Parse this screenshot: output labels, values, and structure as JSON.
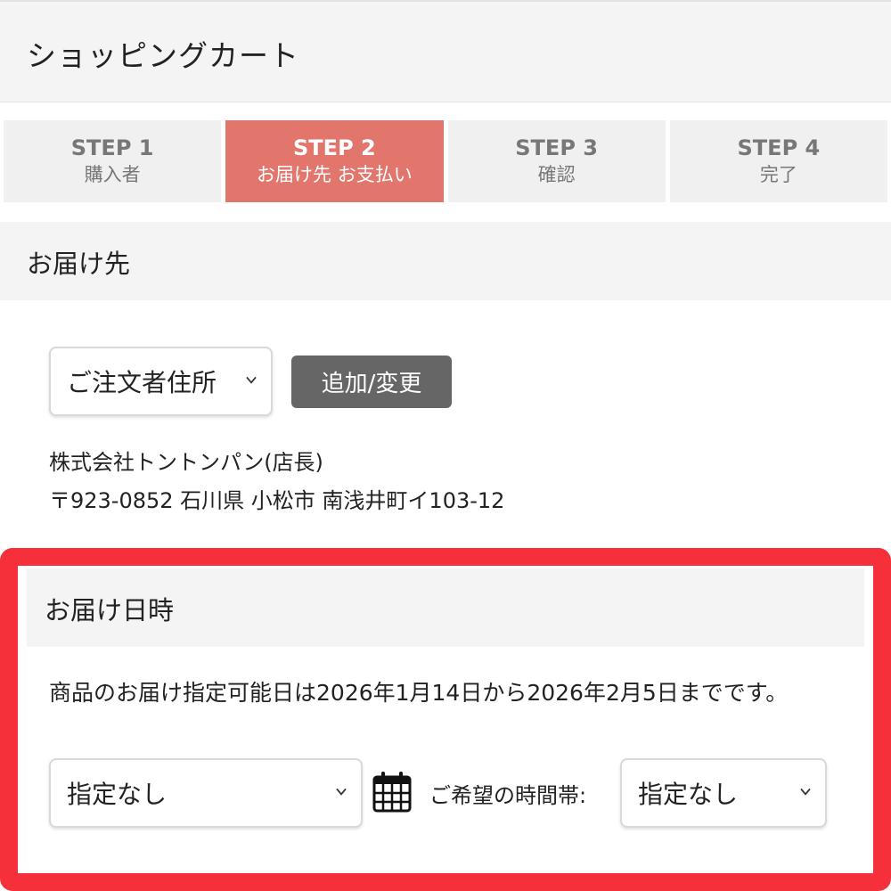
{
  "page": {
    "title": "ショッピングカート"
  },
  "steps": [
    {
      "num": "STEP 1",
      "label": "購入者",
      "active": false
    },
    {
      "num": "STEP 2",
      "label": "お届け先 お支払い",
      "active": true
    },
    {
      "num": "STEP 3",
      "label": "確認",
      "active": false
    },
    {
      "num": "STEP 4",
      "label": "完了",
      "active": false
    }
  ],
  "delivery": {
    "heading": "お届け先",
    "address_select": "ご注文者住所",
    "change_button": "追加/変更",
    "recipient_name": "株式会社トントンパン(店長)",
    "address_line": "〒923-0852 石川県 小松市 南浅井町イ103-12"
  },
  "delivery_datetime": {
    "heading": "お届け日時",
    "notice": "商品のお届け指定可能日は2026年1月14日から2026年2月5日までです。",
    "date_select": "指定なし",
    "time_label": "ご希望の時間帯:",
    "time_select": "指定なし"
  },
  "icons": {
    "calendar": "calendar-icon",
    "chevron": "chevron-down-icon"
  },
  "colors": {
    "active_step": "#e2756c",
    "highlight": "#f5303a",
    "button": "#666666"
  }
}
